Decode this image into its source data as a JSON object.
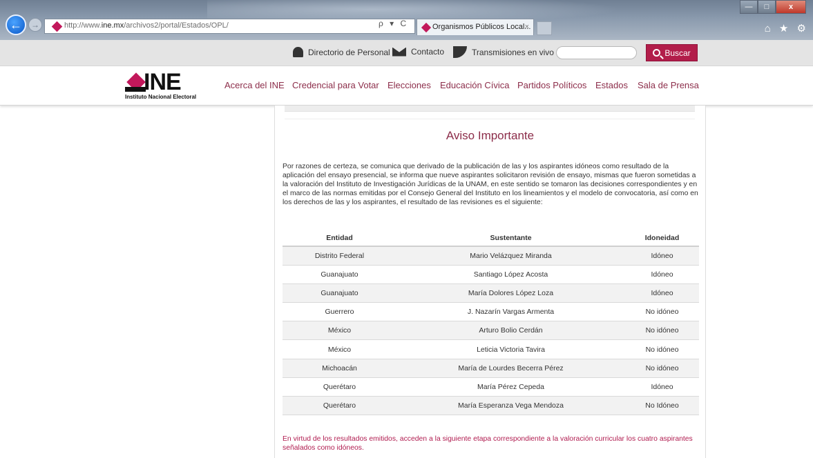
{
  "browser": {
    "url_prefix": "http://www.",
    "url_domain": "ine.mx",
    "url_path": "/archivos2/portal/Estados/OPL/",
    "addr_tools": "ρ ▾ C",
    "tab_title": "Organismos Públicos Local...",
    "tab_close": "×",
    "win_min": "—",
    "win_max": "□",
    "win_close": "x",
    "right_tools": "⌂ ★ ⚙"
  },
  "utility": {
    "directorio": "Directorio de Personal",
    "contacto": "Contacto",
    "transmisiones": "Transmisiones en vivo",
    "search_value": "",
    "search_button": "Buscar"
  },
  "brand": {
    "logo_text": "INE",
    "logo_subtitle": "Instituto Nacional Electoral"
  },
  "nav": {
    "items": [
      "Acerca del INE",
      "Credencial para Votar",
      "Elecciones",
      "Educación Cívica",
      "Partidos Políticos",
      "Estados",
      "Sala de Prensa"
    ]
  },
  "notice": {
    "title": "Aviso Importante",
    "paragraph": "Por razones de certeza, se comunica que derivado de la publicación de las y los aspirantes idóneos como resultado de la aplicación del ensayo presencial, se informa que nueve aspirantes solicitaron revisión de ensayo, mismas que fueron sometidas a la valoración del Instituto de Investigación Jurídicas de la UNAM, en este sentido se tomaron las decisiones correspondientes y en el marco de las normas emitidas por el Consejo General del Instituto en los lineamientos y el modelo de convocatoria, así como en los derechos de las y los aspirantes, el resultado de las revisiones es el siguiente:",
    "table": {
      "headers": [
        "Entidad",
        "Sustentante",
        "Idoneidad"
      ],
      "rows": [
        [
          "Distrito Federal",
          "Mario Velázquez Miranda",
          "Idóneo"
        ],
        [
          "Guanajuato",
          "Santiago López Acosta",
          "Idóneo"
        ],
        [
          "Guanajuato",
          "María Dolores López Loza",
          "Idóneo"
        ],
        [
          "Guerrero",
          "J. Nazarín Vargas Armenta",
          "No idóneo"
        ],
        [
          "México",
          "Arturo Bolio Cerdán",
          "No idóneo"
        ],
        [
          "México",
          "Leticia Victoria Tavira",
          "No idóneo"
        ],
        [
          "Michoacán",
          "María de Lourdes Becerra Pérez",
          "No idóneo"
        ],
        [
          "Querétaro",
          "María Pérez Cepeda",
          "Idóneo"
        ],
        [
          "Querétaro",
          "María Esperanza Vega Mendoza",
          "No Idóneo"
        ]
      ]
    },
    "footnote": "En virtud de los resultados emitidos, acceden a la siguiente etapa correspondiente a la valoración curricular los cuatro aspirantes señalados como idóneos."
  }
}
